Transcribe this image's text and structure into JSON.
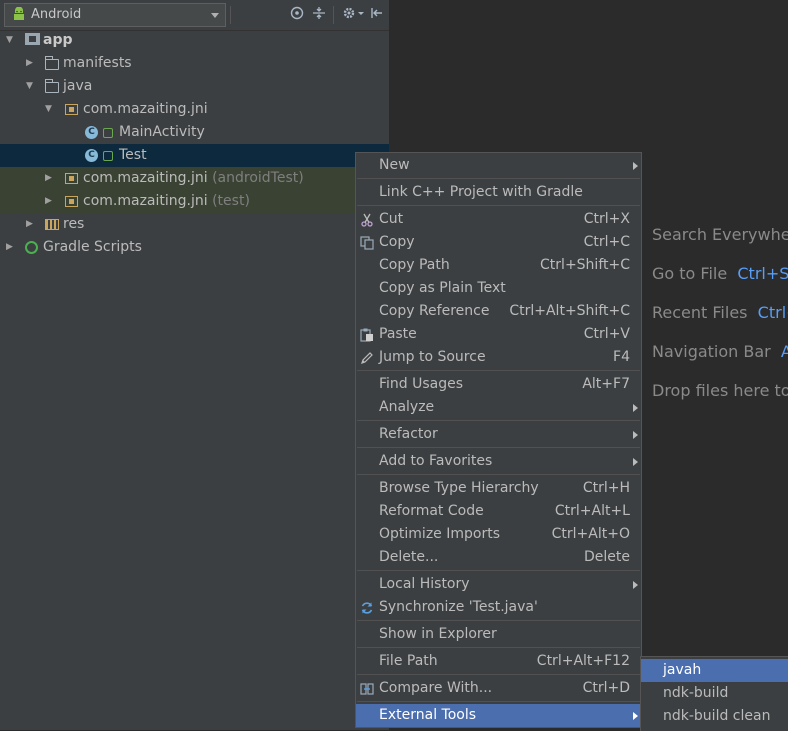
{
  "toolbar": {
    "view_label": "Android"
  },
  "tree": {
    "app": "app",
    "manifests": "manifests",
    "java": "java",
    "pkg_main": "com.mazaiting.jni",
    "main_activity": "MainActivity",
    "test": "Test",
    "pkg_android_test": "com.mazaiting.jni",
    "pkg_android_test_suffix": "(androidTest)",
    "pkg_test": "com.mazaiting.jni",
    "pkg_test_suffix": "(test)",
    "res": "res",
    "gradle_scripts": "Gradle Scripts"
  },
  "editor_hints": {
    "search_everywhere": "Search Everywhere",
    "go_to_file": "Go to File",
    "go_to_file_key": "Ctrl+Sh",
    "recent_files": "Recent Files",
    "recent_files_key": "Ctrl+",
    "navigation_bar": "Navigation Bar",
    "navigation_bar_key": "Al",
    "drop_files": "Drop files here to"
  },
  "context_menu": {
    "new": "New",
    "link_cpp": "Link C++ Project with Gradle",
    "cut": "Cut",
    "cut_key": "Ctrl+X",
    "copy": "Copy",
    "copy_key": "Ctrl+C",
    "copy_path": "Copy Path",
    "copy_path_key": "Ctrl+Shift+C",
    "copy_plain": "Copy as Plain Text",
    "copy_reference": "Copy Reference",
    "copy_reference_key": "Ctrl+Alt+Shift+C",
    "paste": "Paste",
    "paste_key": "Ctrl+V",
    "jump_to_source": "Jump to Source",
    "jump_to_source_key": "F4",
    "find_usages": "Find Usages",
    "find_usages_key": "Alt+F7",
    "analyze": "Analyze",
    "refactor": "Refactor",
    "add_to_favorites": "Add to Favorites",
    "browse_type_hierarchy": "Browse Type Hierarchy",
    "browse_type_hierarchy_key": "Ctrl+H",
    "reformat_code": "Reformat Code",
    "reformat_code_key": "Ctrl+Alt+L",
    "optimize_imports": "Optimize Imports",
    "optimize_imports_key": "Ctrl+Alt+O",
    "delete": "Delete...",
    "delete_key": "Delete",
    "local_history": "Local History",
    "synchronize": "Synchronize 'Test.java'",
    "show_in_explorer": "Show in Explorer",
    "file_path": "File Path",
    "file_path_key": "Ctrl+Alt+F12",
    "compare_with": "Compare With...",
    "compare_with_key": "Ctrl+D",
    "external_tools": "External Tools"
  },
  "submenu": {
    "javah": "javah",
    "ndk_build": "ndk-build",
    "ndk_build_clean": "ndk-build clean"
  },
  "colors": {
    "accent": "#4b6eaf",
    "selection": "#0d293e",
    "link": "#589df6"
  }
}
